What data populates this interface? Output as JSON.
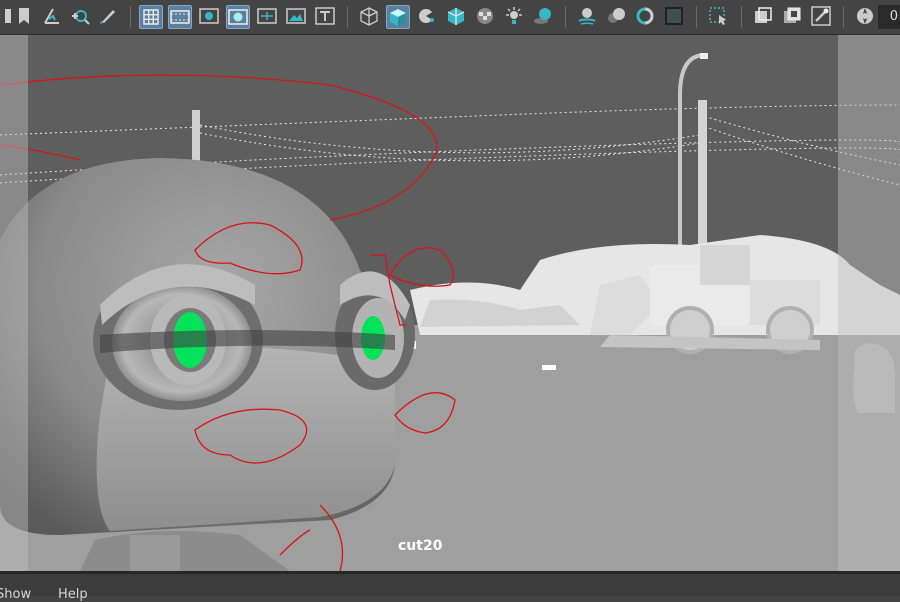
{
  "toolbar": {
    "items": [
      {
        "name": "bookmark-icon",
        "active": false
      },
      {
        "name": "camera-attributes-icon",
        "active": false
      },
      {
        "name": "pan-zoom-icon",
        "active": false
      },
      {
        "name": "grease-pencil-icon",
        "active": false
      },
      {
        "name": "grid-icon",
        "active": true
      },
      {
        "name": "film-gate-icon",
        "active": true
      },
      {
        "name": "resolution-gate-icon",
        "active": false
      },
      {
        "name": "gate-mask-icon",
        "active": true
      },
      {
        "name": "field-chart-icon",
        "active": false
      },
      {
        "name": "safe-action-icon",
        "active": false
      },
      {
        "name": "safe-title-icon",
        "active": false
      },
      {
        "name": "wireframe-icon",
        "active": false
      },
      {
        "name": "smooth-shade-icon",
        "active": true
      },
      {
        "name": "use-default-material-icon",
        "active": false
      },
      {
        "name": "wireframe-on-shaded-icon",
        "active": false
      },
      {
        "name": "textured-icon",
        "active": false
      },
      {
        "name": "use-lights-icon",
        "active": false
      },
      {
        "name": "shadows-icon",
        "active": false
      },
      {
        "name": "screen-space-reflection-icon",
        "active": false
      },
      {
        "name": "motion-blur-icon",
        "active": false
      },
      {
        "name": "ambient-occlusion-icon",
        "active": false
      },
      {
        "name": "anti-aliasing-icon",
        "active": false
      },
      {
        "name": "isolate-select-icon",
        "active": false
      },
      {
        "name": "xray-icon",
        "active": false
      },
      {
        "name": "xray-active-components-icon",
        "active": false
      },
      {
        "name": "xray-joints-icon",
        "active": false
      },
      {
        "name": "exposure-icon",
        "active": false
      }
    ],
    "frame_value": "0"
  },
  "viewport": {
    "camera_label": "cut20",
    "background_color": "#9c9c9c",
    "sky_color": "#5e5e5e",
    "eye_color": "#00e35a",
    "curve_color": "#d8131b"
  },
  "menubar": {
    "items": [
      {
        "label": "Show"
      },
      {
        "label": "Help"
      }
    ]
  }
}
